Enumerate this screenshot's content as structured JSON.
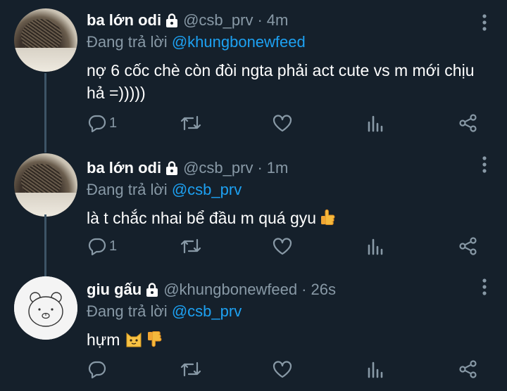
{
  "tweets": [
    {
      "display_name": "ba lớn odi",
      "handle": "@csb_prv",
      "separator": "·",
      "time": "4m",
      "reply_prefix": "Đang trả lời",
      "reply_to": "@khungbonewfeed",
      "text": "nợ 6 cốc chè còn đòi ngta phải act cute vs m mới chịu hả =)))))",
      "reply_count": "1",
      "avatar": "hedgehog",
      "locked": true
    },
    {
      "display_name": "ba lớn odi",
      "handle": "@csb_prv",
      "separator": "·",
      "time": "1m",
      "reply_prefix": "Đang trả lời",
      "reply_to": "@csb_prv",
      "text": "là t chắc nhai bể đầu m quá gyu",
      "text_emoji": [
        "thumbs-up"
      ],
      "reply_count": "1",
      "avatar": "hedgehog",
      "locked": true
    },
    {
      "display_name": "giu gấu",
      "handle": "@khungbonewfeed",
      "separator": "·",
      "time": "26s",
      "reply_prefix": "Đang trả lời",
      "reply_to": "@csb_prv",
      "text": "hựm",
      "text_emoji": [
        "cat-face",
        "thumbs-down"
      ],
      "reply_count": "",
      "avatar": "bear",
      "locked": true
    }
  ],
  "icons": {
    "reply": "reply-icon",
    "retweet": "retweet-icon",
    "like": "heart-icon",
    "stats": "analytics-icon",
    "share": "share-icon",
    "more": "more-vertical-icon",
    "lock": "lock-icon"
  },
  "colors": {
    "background": "#15202b",
    "text": "#ffffff",
    "muted": "#8899a6",
    "link": "#1da1f2",
    "thread_line": "#3d5466"
  }
}
